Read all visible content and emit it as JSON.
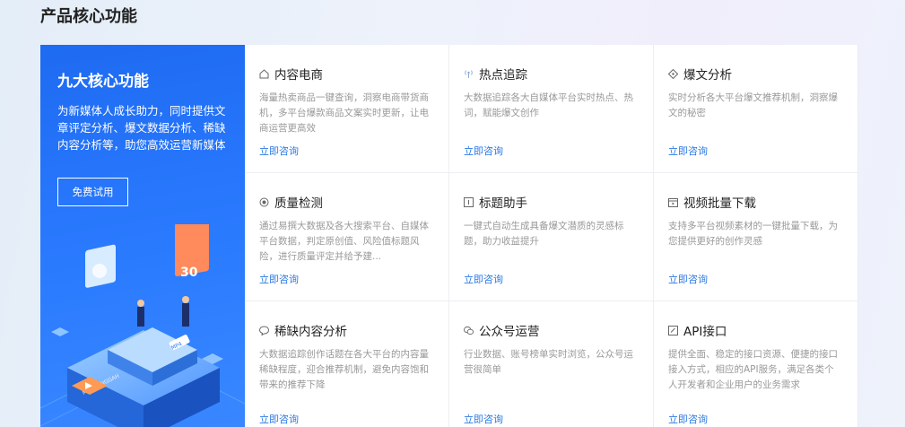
{
  "section": {
    "title": "产品核心功能"
  },
  "intro": {
    "title": "九大核心功能",
    "description": "为新媒体人成长助力，同时提供文章评定分析、爆文数据分析、稀缺内容分析等，助您高效运营新媒体",
    "trial_button": "免费试用",
    "illustration_text": [
      "30",
      "MENGUNGGAH",
      "MP4"
    ]
  },
  "colors": {
    "accent": "#2a78e4",
    "intro_bg": "#2b7bff"
  },
  "features": [
    {
      "icon": "home-icon",
      "title": "内容电商",
      "desc": "海量热卖商品一键查询，洞察电商带货商机，多平台爆款商品文案实时更新，让电商运营更高效",
      "link": "立即咨询"
    },
    {
      "icon": "broadcast-icon",
      "title": "热点追踪",
      "desc": "大数据追踪各大自媒体平台实时热点、热词，赋能爆文创作",
      "link": "立即咨询"
    },
    {
      "icon": "diamond-icon",
      "title": "爆文分析",
      "desc": "实时分析各大平台爆文推荐机制，洞察爆文的秘密",
      "link": "立即咨询"
    },
    {
      "icon": "quality-icon",
      "title": "质量检测",
      "desc": "通过易撰大数据及各大搜索平台、自媒体平台数据，判定原创值、风险值标题风险，进行质量评定并给予建...",
      "link": "立即咨询"
    },
    {
      "icon": "title-icon",
      "title": "标题助手",
      "desc": "一键式自动生成具备爆文潜质的灵感标题，助力收益提升",
      "link": "立即咨询"
    },
    {
      "icon": "download-icon",
      "title": "视频批量下载",
      "desc": "支持多平台视频素材的一键批量下载，为您提供更好的创作灵感",
      "link": "立即咨询"
    },
    {
      "icon": "comment-icon",
      "title": "稀缺内容分析",
      "desc": "大数据追踪创作话题在各大平台的内容量稀缺程度，迎合推荐机制，避免内容饱和带来的推荐下降",
      "link": "立即咨询"
    },
    {
      "icon": "wechat-icon",
      "title": "公众号运营",
      "desc": "行业数据、账号榜单实时浏览，公众号运营很简单",
      "link": "立即咨询"
    },
    {
      "icon": "api-icon",
      "title": "API接口",
      "desc": "提供全面、稳定的接口资源、便捷的接口接入方式，相应的API服务，满足各类个人开发者和企业用户的业务需求",
      "link": "立即咨询"
    }
  ]
}
